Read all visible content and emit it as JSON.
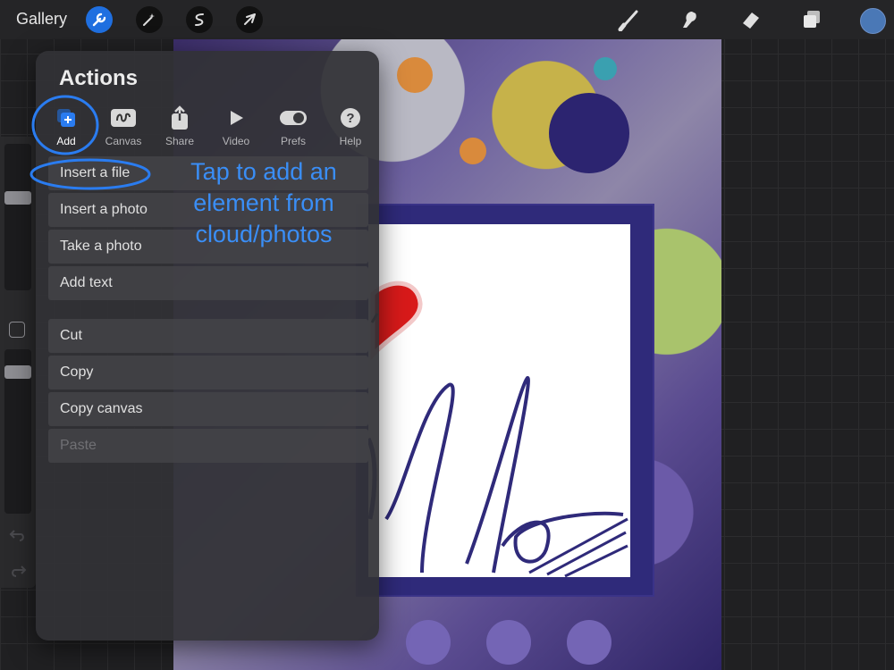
{
  "topbar": {
    "gallery_label": "Gallery",
    "left_tools": [
      "wrench-icon",
      "magic-wand-icon",
      "selection-icon",
      "transform-arrow-icon"
    ],
    "right_tools": [
      "brush-icon",
      "smudge-icon",
      "eraser-icon",
      "layers-icon"
    ],
    "active_color": "#4a78b6"
  },
  "panel": {
    "title": "Actions",
    "tabs": [
      {
        "label": "Add",
        "icon": "add-image-icon"
      },
      {
        "label": "Canvas",
        "icon": "canvas-icon"
      },
      {
        "label": "Share",
        "icon": "share-icon"
      },
      {
        "label": "Video",
        "icon": "play-icon"
      },
      {
        "label": "Prefs",
        "icon": "toggle-icon"
      },
      {
        "label": "Help",
        "icon": "help-icon"
      }
    ],
    "group1": [
      "Insert a file",
      "Insert a photo",
      "Take a photo",
      "Add text"
    ],
    "group2": [
      "Cut",
      "Copy",
      "Copy canvas",
      "Paste"
    ]
  },
  "annotation": {
    "line1": "Tap to add an",
    "line2": "element from",
    "line3": "cloud/photos",
    "color": "#3a8ef6"
  },
  "canvas": {
    "frame_color": "#2f2a7a",
    "heart_color": "#d81a1a"
  }
}
